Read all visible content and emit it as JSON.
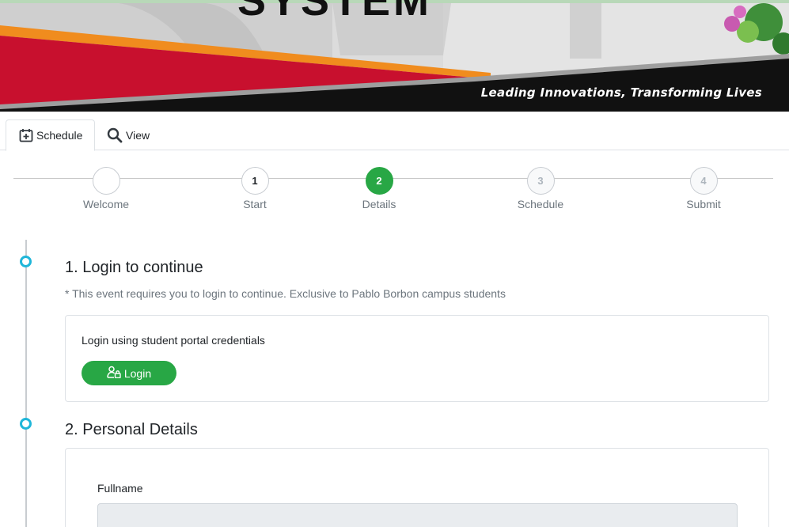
{
  "banner": {
    "title": "SYSTEM",
    "tagline": "Leading Innovations, Transforming Lives"
  },
  "tabs": [
    {
      "label": "Schedule",
      "icon": "calendar-plus-icon",
      "active": true
    },
    {
      "label": "View",
      "icon": "search-icon",
      "active": false
    }
  ],
  "stepper": {
    "steps": [
      {
        "number": "",
        "label": "Welcome",
        "state": "done"
      },
      {
        "number": "1",
        "label": "Start",
        "state": "done"
      },
      {
        "number": "2",
        "label": "Details",
        "state": "active"
      },
      {
        "number": "3",
        "label": "Schedule",
        "state": "pending"
      },
      {
        "number": "4",
        "label": "Submit",
        "state": "pending"
      }
    ]
  },
  "login_section": {
    "title": "1. Login to continue",
    "note": "* This event requires you to login to continue. Exclusive to Pablo Borbon campus students",
    "card_text": "Login using student portal credentials",
    "button_label": "Login"
  },
  "personal_section": {
    "title": "2. Personal Details",
    "fullname_label": "Fullname",
    "fullname_value": ""
  },
  "colors": {
    "accent_green": "#28a745",
    "timeline_cyan": "#1fb6d9",
    "banner_red": "#c8102e"
  }
}
